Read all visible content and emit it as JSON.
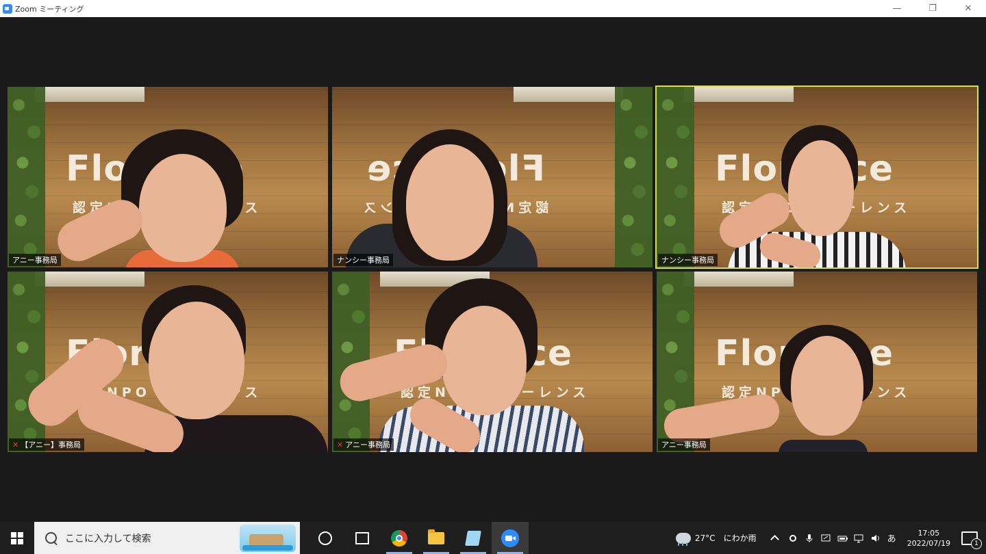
{
  "window": {
    "title": "Zoom ミーティング",
    "controls": {
      "minimize": "—",
      "restore": "❐",
      "close": "✕"
    }
  },
  "colors": {
    "active_speaker": "#d6e24a",
    "zoom_blue": "#2d8cff",
    "mute_red": "#e53935"
  },
  "brand": {
    "logo": "Florence",
    "logo_sub": "認定NPO フローレンス"
  },
  "participants": [
    {
      "name": "アニー事務局",
      "muted": false,
      "active": false,
      "mirrored": false
    },
    {
      "name": "ナンシー事務局",
      "muted": false,
      "active": false,
      "mirrored": true
    },
    {
      "name": "ナンシー事務局",
      "muted": false,
      "active": true,
      "mirrored": false
    },
    {
      "name": "【アニー】事務局",
      "muted": true,
      "active": false,
      "mirrored": false
    },
    {
      "name": "アニー事務局",
      "muted": true,
      "active": false,
      "mirrored": false
    },
    {
      "name": "アニー事務局",
      "muted": false,
      "active": false,
      "mirrored": false
    }
  ],
  "taskbar": {
    "search_placeholder": "ここに入力して検索",
    "apps": [
      {
        "name": "cortana",
        "icon": "circle-icon"
      },
      {
        "name": "task-view",
        "icon": "task-view-icon"
      },
      {
        "name": "chrome",
        "icon": "chrome-icon"
      },
      {
        "name": "file-explorer",
        "icon": "folder-icon"
      },
      {
        "name": "notepad",
        "icon": "notepad-icon"
      },
      {
        "name": "zoom",
        "icon": "zoom-icon"
      }
    ],
    "weather": {
      "temp": "27°C",
      "desc": "にわか雨"
    },
    "ime": "あ",
    "time": "17:05",
    "date": "2022/07/19",
    "notification_count": "1"
  }
}
